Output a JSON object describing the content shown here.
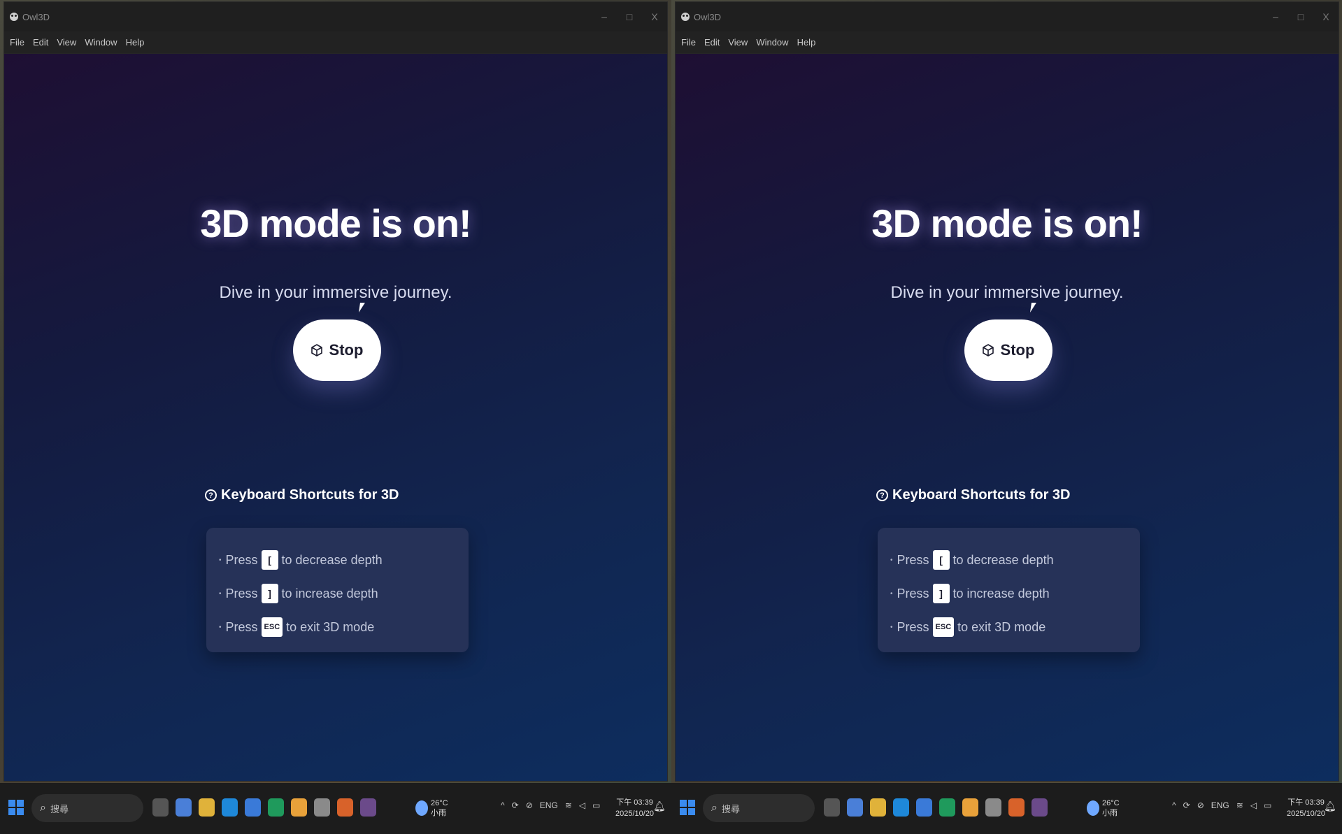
{
  "window": {
    "title": "Owl3D",
    "minimize": "–",
    "maximize": "□",
    "close": "X"
  },
  "menu": [
    "File",
    "Edit",
    "View",
    "Window",
    "Help"
  ],
  "main": {
    "headline": "3D mode is on!",
    "subline": "Dive in your immersive journey.",
    "stop_label": "Stop",
    "shortcuts_title": "Keyboard Shortcuts for 3D",
    "help_glyph": "?",
    "shortcuts": [
      {
        "prefix": "Press",
        "key": "[",
        "suffix": "to decrease depth"
      },
      {
        "prefix": "Press",
        "key": "]",
        "suffix": "to increase depth"
      },
      {
        "prefix": "Press",
        "key": "ESC",
        "suffix": "to exit 3D mode"
      }
    ]
  },
  "taskbar": {
    "search_placeholder": "搜尋",
    "weather_temp": "26°C",
    "weather_desc": "小雨",
    "lang": "ENG",
    "tray_chevron": "^",
    "time": "下午 03:39",
    "date": "2025/10/20",
    "icons": [
      "file-explorer-icon",
      "copilot-icon",
      "folder-icon",
      "edge-icon",
      "store-icon",
      "app-green-icon",
      "chrome-icon",
      "notepad-icon",
      "office-icon",
      "owl3d-icon"
    ]
  },
  "colors": {
    "accent": "#3a8bef",
    "content_bg_start": "#1e0f33",
    "content_bg_end": "#0d2d5e",
    "card_bg": "#263258"
  }
}
